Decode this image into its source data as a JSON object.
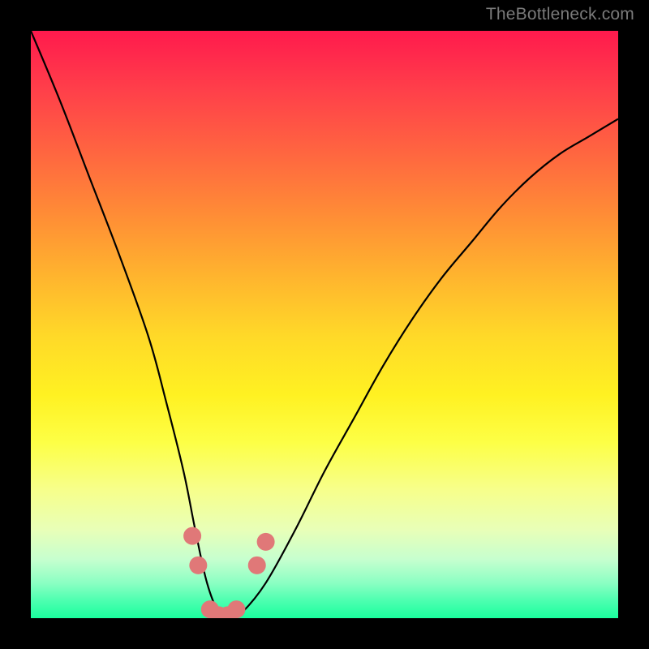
{
  "watermark": "TheBottleneck.com",
  "chart_data": {
    "type": "line",
    "title": "",
    "xlabel": "",
    "ylabel": "",
    "xlim": [
      0,
      100
    ],
    "ylim": [
      0,
      100
    ],
    "x": [
      0,
      5,
      10,
      15,
      20,
      23,
      26,
      28,
      30,
      32,
      34,
      36,
      40,
      45,
      50,
      55,
      60,
      65,
      70,
      75,
      80,
      85,
      90,
      95,
      100
    ],
    "values": [
      100,
      88,
      75,
      62,
      48,
      37,
      25,
      15,
      6,
      1,
      0,
      1,
      6,
      15,
      25,
      34,
      43,
      51,
      58,
      64,
      70,
      75,
      79,
      82,
      85
    ],
    "markers": [
      {
        "x": 27.5,
        "y": 14
      },
      {
        "x": 28.5,
        "y": 9
      },
      {
        "x": 30.5,
        "y": 1.5
      },
      {
        "x": 32.0,
        "y": 0.5
      },
      {
        "x": 33.5,
        "y": 0.5
      },
      {
        "x": 35.0,
        "y": 1.5
      },
      {
        "x": 38.5,
        "y": 9
      },
      {
        "x": 40.0,
        "y": 13
      }
    ],
    "marker_color": "#e07878",
    "curve_color": "#000000",
    "background": "rainbow-gradient"
  }
}
